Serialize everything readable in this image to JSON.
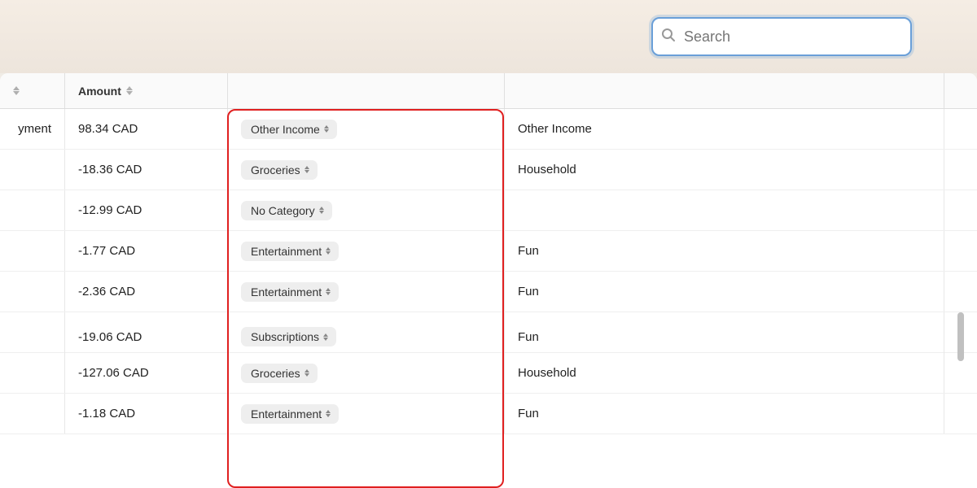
{
  "topbar": {
    "search_placeholder": "Search"
  },
  "table": {
    "headers": [
      {
        "id": "col-sort",
        "label": ""
      },
      {
        "id": "col-amount",
        "label": "Amount",
        "sortable": true
      },
      {
        "id": "col-category",
        "label": ""
      },
      {
        "id": "col-group",
        "label": ""
      },
      {
        "id": "col-scroll",
        "label": ""
      }
    ],
    "rows": [
      {
        "partial_label": "yment",
        "amount": "98.34 CAD",
        "amount_sign": "positive",
        "category": "Other Income",
        "group": "Other Income"
      },
      {
        "partial_label": "",
        "amount": "-18.36 CAD",
        "amount_sign": "negative",
        "category": "Groceries",
        "group": "Household"
      },
      {
        "partial_label": "",
        "amount": "-12.99 CAD",
        "amount_sign": "negative",
        "category": "No Category",
        "group": ""
      },
      {
        "partial_label": "",
        "amount": "-1.77 CAD",
        "amount_sign": "negative",
        "category": "Entertainment",
        "group": "Fun"
      },
      {
        "partial_label": "",
        "amount": "-2.36 CAD",
        "amount_sign": "negative",
        "category": "Entertainment",
        "group": "Fun"
      },
      {
        "partial_label": "",
        "amount": "-19.06 CAD",
        "amount_sign": "negative",
        "category": "Subscriptions",
        "group": "Fun"
      },
      {
        "partial_label": "",
        "amount": "-127.06 CAD",
        "amount_sign": "negative",
        "category": "Groceries",
        "group": "Household"
      },
      {
        "partial_label": "",
        "amount": "-1.18 CAD",
        "amount_sign": "negative",
        "category": "Entertainment",
        "group": "Fun"
      }
    ]
  }
}
